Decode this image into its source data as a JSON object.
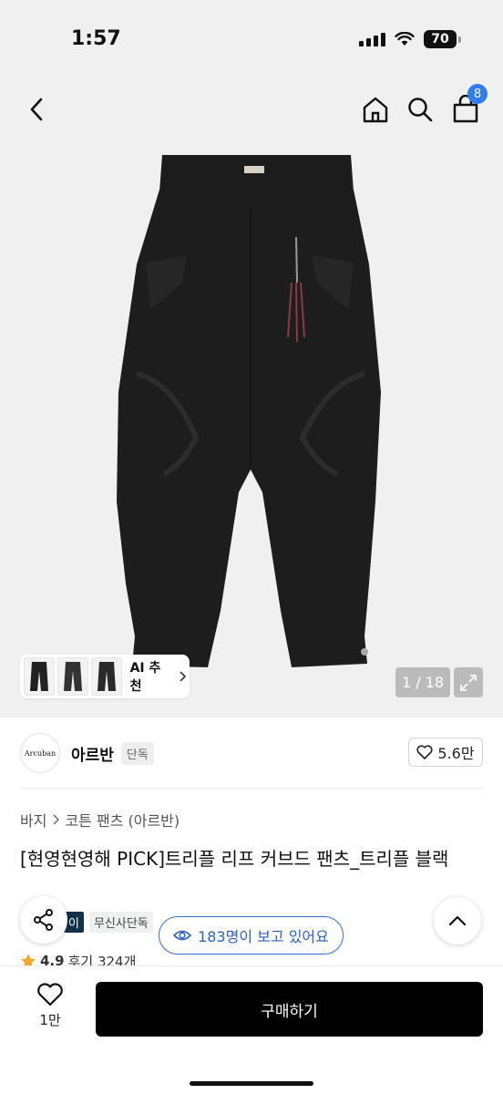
{
  "status_bar": {
    "time": "1:57",
    "battery": "70"
  },
  "header": {
    "cart_count": "8"
  },
  "gallery": {
    "ai_recommend_label": "AI 추천",
    "page_indicator": "1 / 18"
  },
  "brand": {
    "logo_text": "Arcuban",
    "name": "아르반",
    "tag": "단독",
    "like_count": "5.6만"
  },
  "breadcrumb": {
    "category": "바지",
    "subcategory": "코튼 팬츠 (아르반)"
  },
  "product": {
    "title": "[현영현영해 PICK]트리플 리프 커브드 팬츠_트리플 블랙",
    "badges": [
      "이",
      "무신사단독"
    ],
    "rating": "4.9",
    "reviews": "후기 324개"
  },
  "floating": {
    "viewers": "183명이 보고 있어요"
  },
  "bottom_bar": {
    "wish_count": "1만",
    "buy_label": "구매하기"
  },
  "colors": {
    "accent_blue": "#3a72d8",
    "cart_badge": "#2f7df6",
    "badge_dark": "#11324d",
    "rating_star": "#f5a623"
  }
}
